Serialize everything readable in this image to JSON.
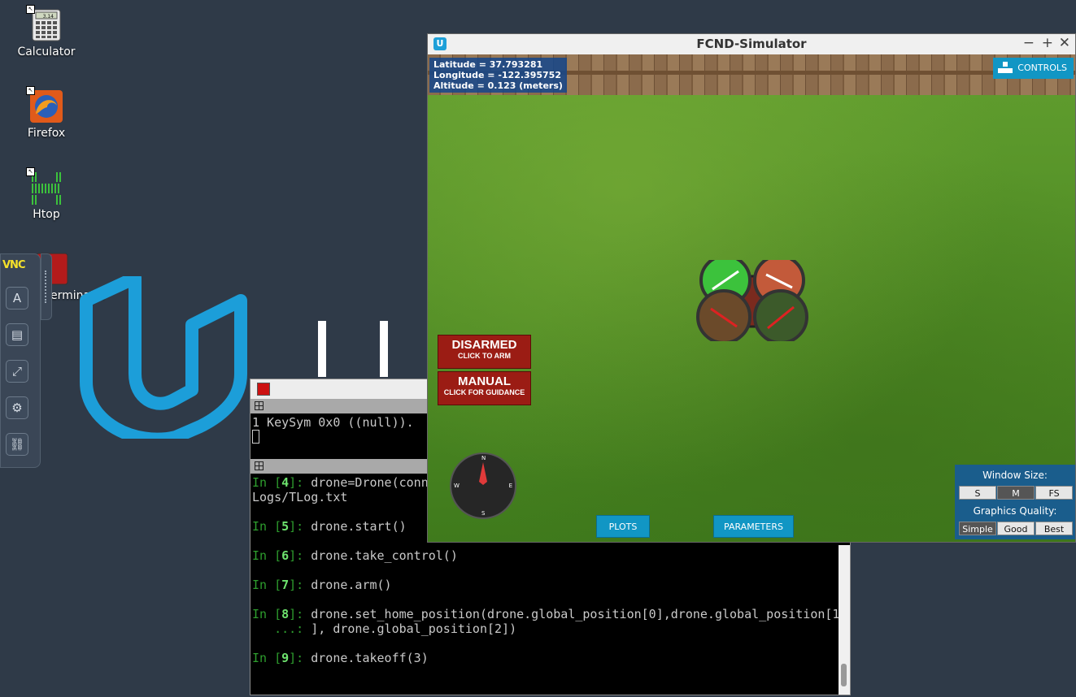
{
  "desktop": {
    "icons": [
      {
        "label": "Calculator",
        "icon": "calculator-icon"
      },
      {
        "label": "Firefox",
        "icon": "firefox-icon"
      },
      {
        "label": "Htop",
        "icon": "htop-icon"
      },
      {
        "label": "erminator",
        "icon": "terminator-icon"
      }
    ]
  },
  "vnc": {
    "logo": "VNC",
    "buttons": [
      "keyboard-icon",
      "clipboard-icon",
      "fullscreen-icon",
      "gear-icon",
      "disconnect-icon"
    ]
  },
  "terminal": {
    "pane1_line": "1 KeySym 0x0 ((null)).",
    "lines": [
      {
        "prompt_in": "In [",
        "num": "4",
        "prompt_end": "]: ",
        "code": "drone=Drone(conn"
      },
      {
        "text": "Logs/TLog.txt"
      },
      {
        "prompt_in": "In [",
        "num": "5",
        "prompt_end": "]: ",
        "code": "drone.start()"
      },
      {
        "prompt_in": "In [",
        "num": "6",
        "prompt_end": "]: ",
        "code": "drone.take_control()"
      },
      {
        "prompt_in": "In [",
        "num": "7",
        "prompt_end": "]: ",
        "code": "drone.arm()"
      },
      {
        "prompt_in": "In [",
        "num": "8",
        "prompt_end": "]: ",
        "code": "drone.set_home_position(drone.global_position[0],drone.global_position[1"
      },
      {
        "cont": "   ...: ",
        "code": "], drone.global_position[2])"
      },
      {
        "prompt_in": "In [",
        "num": "9",
        "prompt_end": "]: ",
        "code": "drone.takeoff(3)"
      }
    ]
  },
  "simulator": {
    "title": "FCND-Simulator",
    "window_controls": [
      "−",
      "+",
      "✕"
    ],
    "telemetry": {
      "latitude": "Latitude = 37.793281",
      "longitude": "Longitude = -122.395752",
      "altitude": "Altitude = 0.123 (meters)"
    },
    "controls_label": "CONTROLS",
    "arm_button": {
      "main": "DISARMED",
      "sub": "CLICK TO ARM"
    },
    "mode_button": {
      "main": "MANUAL",
      "sub": "CLICK FOR GUIDANCE"
    },
    "compass": {
      "n": "N",
      "e": "E",
      "s": "S",
      "w": "W"
    },
    "plots_label": "PLOTS",
    "parameters_label": "PARAMETERS",
    "window_size": {
      "title": "Window Size:",
      "options": [
        "S",
        "M",
        "FS"
      ],
      "selected": "M"
    },
    "graphics_quality": {
      "title": "Graphics Quality:",
      "options": [
        "Simple",
        "Good",
        "Best"
      ],
      "selected": "Simple"
    }
  }
}
